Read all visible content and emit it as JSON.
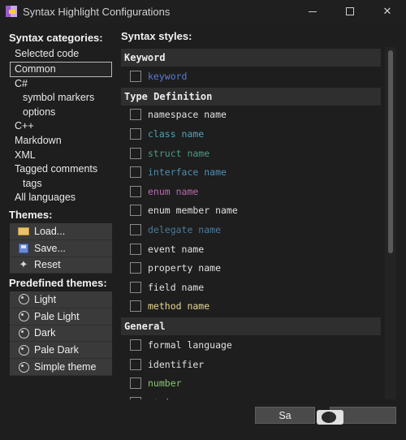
{
  "window": {
    "title": "Syntax Highlight Configurations",
    "minimize_icon": "minimize-icon",
    "maximize_icon": "maximize-icon",
    "close_glyph": "✕"
  },
  "categories": {
    "heading": "Syntax categories:",
    "items": [
      {
        "label": "Selected code",
        "indent": false,
        "selected": false
      },
      {
        "label": "Common",
        "indent": false,
        "selected": true
      },
      {
        "label": "C#",
        "indent": false,
        "selected": false
      },
      {
        "label": "symbol markers",
        "indent": true,
        "selected": false
      },
      {
        "label": "options",
        "indent": true,
        "selected": false
      },
      {
        "label": "C++",
        "indent": false,
        "selected": false
      },
      {
        "label": "Markdown",
        "indent": false,
        "selected": false
      },
      {
        "label": "XML",
        "indent": false,
        "selected": false
      },
      {
        "label": "Tagged comments",
        "indent": false,
        "selected": false
      },
      {
        "label": "tags",
        "indent": true,
        "selected": false
      },
      {
        "label": "All languages",
        "indent": false,
        "selected": false
      }
    ]
  },
  "themes": {
    "heading": "Themes:",
    "buttons": [
      {
        "label": "Load...",
        "icon": "folder-icon"
      },
      {
        "label": "Save...",
        "icon": "save-icon"
      },
      {
        "label": "Reset",
        "icon": "broom-icon"
      }
    ]
  },
  "predefined": {
    "heading": "Predefined themes:",
    "buttons": [
      {
        "label": "Light",
        "icon": "palette-icon"
      },
      {
        "label": "Pale Light",
        "icon": "palette-icon"
      },
      {
        "label": "Dark",
        "icon": "palette-icon"
      },
      {
        "label": "Pale Dark",
        "icon": "palette-icon"
      },
      {
        "label": "Simple theme",
        "icon": "palette-icon"
      }
    ]
  },
  "styles": {
    "heading": "Syntax styles:",
    "groups": [
      {
        "name": "Keyword",
        "items": [
          {
            "label": "keyword",
            "color": "#5a7ad8"
          }
        ]
      },
      {
        "name": "Type Definition",
        "items": [
          {
            "label": "namespace name",
            "color": "#e0e0e0"
          },
          {
            "label": "class name",
            "color": "#4fa3b8"
          },
          {
            "label": "struct name",
            "color": "#4a9a86"
          },
          {
            "label": "interface name",
            "color": "#4f8fb0"
          },
          {
            "label": "enum name",
            "color": "#b86ab0"
          },
          {
            "label": "enum member name",
            "color": "#e0e0e0"
          },
          {
            "label": "delegate name",
            "color": "#4a7a9a"
          },
          {
            "label": "event name",
            "color": "#e0e0e0"
          },
          {
            "label": "property name",
            "color": "#e0e0e0"
          },
          {
            "label": "field name",
            "color": "#e0e0e0"
          },
          {
            "label": "method name",
            "color": "#e8d890"
          }
        ]
      },
      {
        "name": "General",
        "items": [
          {
            "label": "formal language",
            "color": "#e0e0e0"
          },
          {
            "label": "identifier",
            "color": "#e0e0e0"
          },
          {
            "label": "number",
            "color": "#8ac870"
          },
          {
            "label": "string",
            "color": "#e0e0e0"
          }
        ]
      }
    ]
  },
  "bottom": {
    "save_label": "Sa",
    "watermark_text": ""
  }
}
